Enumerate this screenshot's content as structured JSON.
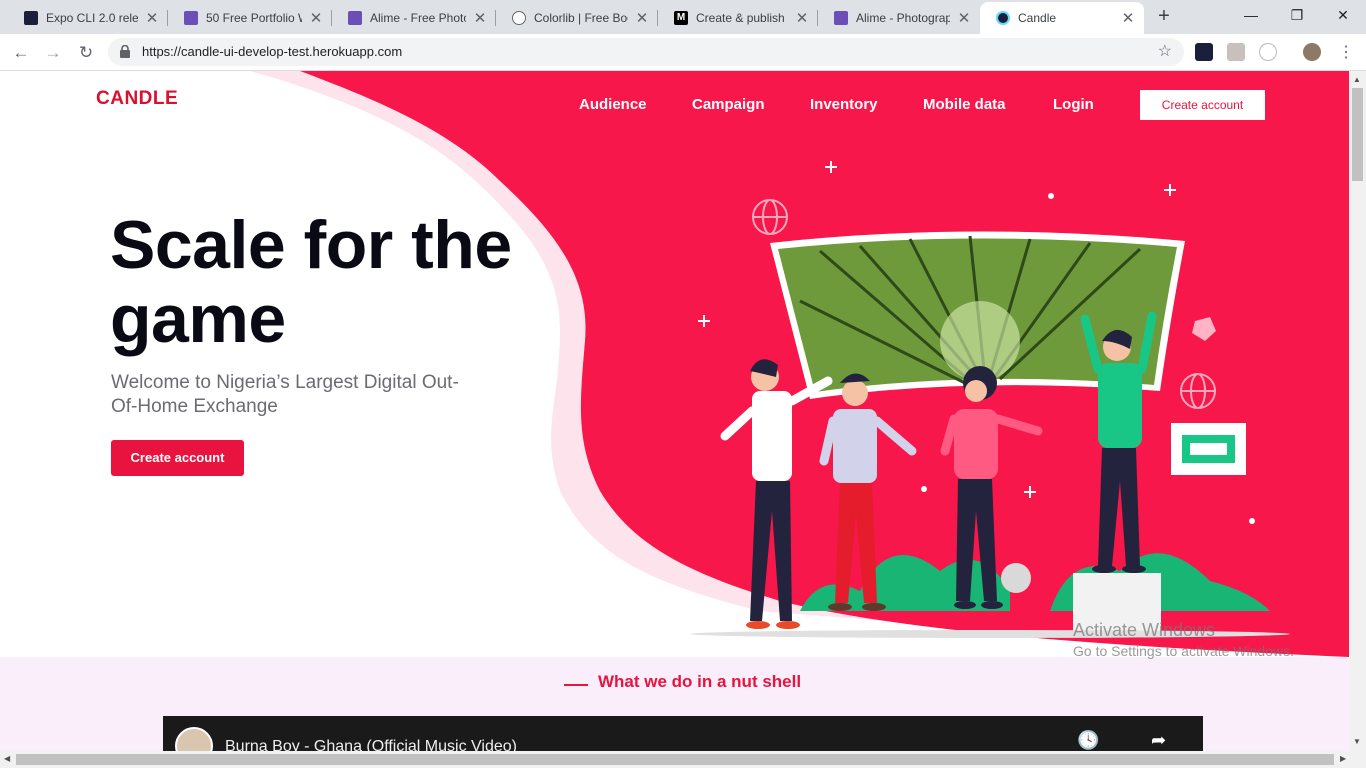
{
  "browser": {
    "tabs": [
      {
        "title": "Expo CLI 2.0 releas",
        "icon": "expo-icon",
        "color": "#1b1f3b"
      },
      {
        "title": "50 Free Portfolio W",
        "icon": "colorlib-icon",
        "color": "#6a4fb6"
      },
      {
        "title": "Alime - Free Photo",
        "icon": "colorlib-icon",
        "color": "#6a4fb6"
      },
      {
        "title": "Colorlib | Free Boo",
        "icon": "wordpress-icon",
        "color": "#666666"
      },
      {
        "title": "Create & publish y",
        "icon": "medium-icon",
        "color": "#000000"
      },
      {
        "title": "Alime - Photograp",
        "icon": "colorlib-icon",
        "color": "#6a4fb6"
      },
      {
        "title": "Candle",
        "icon": "react-icon",
        "color": "#61dafb"
      }
    ],
    "url": "https://candle-ui-develop-test.herokuapp.com"
  },
  "header": {
    "logo": "CANDLE",
    "nav": [
      "Audience",
      "Campaign",
      "Inventory",
      "Mobile data",
      "Login"
    ],
    "cta": "Create account"
  },
  "hero": {
    "title": "Scale for the game",
    "subtitle": "Welcome to Nigeria’s Largest Digital Out-Of-Home Exchange",
    "cta": "Create account"
  },
  "section": {
    "title": "What we do in a nut shell",
    "video_title": "Burna Boy - Ghana (Official Music Video)"
  },
  "watermark": {
    "line1": "Activate Windows",
    "line2": "Go to Settings to activate Windows."
  },
  "colors": {
    "brand": "#e8143f",
    "logo": "#d9112f",
    "section_bg": "#f9eef9"
  }
}
